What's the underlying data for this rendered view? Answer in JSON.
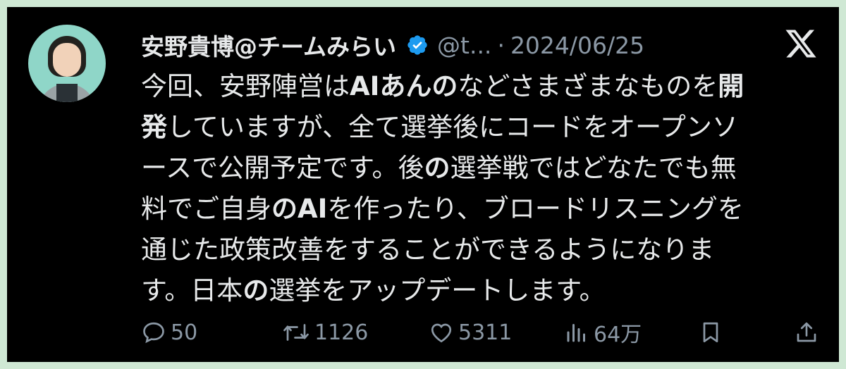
{
  "tweet": {
    "author_name": "安野貴博@チームみらい",
    "handle": "@t...",
    "separator": "·",
    "date": "2024/06/25",
    "body_lines": [
      [
        {
          "t": "今回、安野陣営は"
        },
        {
          "t": "AIあんの",
          "b": true
        },
        {
          "t": "などさまざまなものを"
        },
        {
          "t": "開",
          "b": true
        }
      ],
      [
        {
          "t": "発",
          "b": true
        },
        {
          "t": "していますが、全て選挙後にコードをオープンソ"
        }
      ],
      [
        {
          "t": "ースで公開予定です。後"
        },
        {
          "t": "の",
          "b": true
        },
        {
          "t": "選挙戦ではどなたでも無"
        }
      ],
      [
        {
          "t": "料でご自身"
        },
        {
          "t": "のAI",
          "b": true
        },
        {
          "t": "を作ったり、ブロードリスニングを"
        }
      ],
      [
        {
          "t": "通じた政策改善をすることができるようになりま"
        }
      ],
      [
        {
          "t": "す。日本"
        },
        {
          "t": "の",
          "b": true
        },
        {
          "t": "選挙をアップデートします。"
        }
      ]
    ]
  },
  "stats": {
    "replies": "50",
    "retweets": "1126",
    "likes": "5311",
    "views": "64万"
  },
  "icons": {
    "verified": "verified-badge-icon",
    "platform": "x-logo-icon",
    "reply": "reply-icon",
    "retweet": "retweet-icon",
    "like": "heart-icon",
    "views": "views-icon",
    "bookmark": "bookmark-icon",
    "share": "share-icon"
  },
  "colors": {
    "background": "#000000",
    "text": "#e7e9ea",
    "muted": "#8b98a5",
    "verified": "#1d9bf0",
    "page_border": "#cfe8d4"
  }
}
